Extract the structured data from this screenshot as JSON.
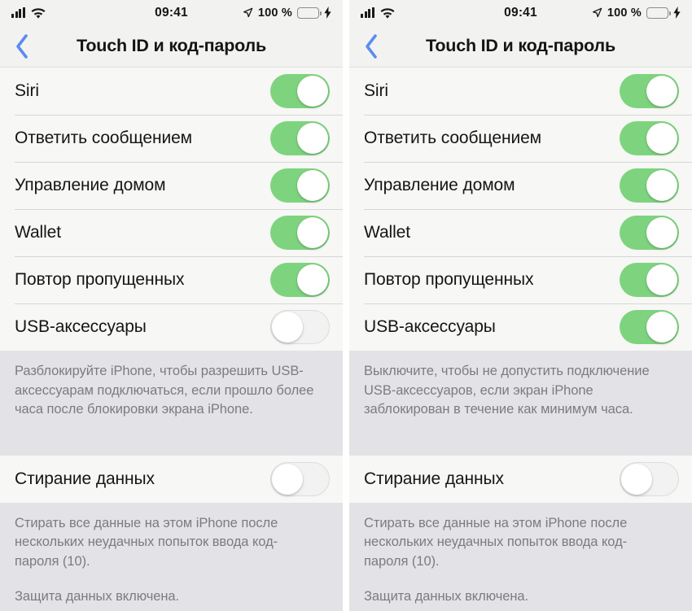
{
  "panels": [
    {
      "id": "left",
      "status_bar": {
        "signal_icon": "cellular-signal-icon",
        "wifi_icon": "wifi-icon",
        "time": "09:41",
        "location_icon": "location-arrow-icon",
        "battery_percent": "100 %",
        "battery_icon": "battery-full-icon",
        "charging_icon": "lightning-bolt-icon"
      },
      "nav": {
        "back_icon": "chevron-left-icon",
        "title": "Touch ID и код-пароль"
      },
      "sections": [
        {
          "rows": [
            {
              "label": "Siri",
              "toggle": "on"
            },
            {
              "label": "Ответить сообщением",
              "toggle": "on"
            },
            {
              "label": "Управление домом",
              "toggle": "on"
            },
            {
              "label": "Wallet",
              "toggle": "on"
            },
            {
              "label": "Повтор пропущенных",
              "toggle": "on"
            },
            {
              "label": "USB-аксессуары",
              "toggle": "off"
            }
          ],
          "footer": [
            "Разблокируйте iPhone, чтобы разрешить USB-аксессуарам подключаться, если прошло более часа после блокировки экрана iPhone."
          ]
        },
        {
          "rows": [
            {
              "label": "Стирание данных",
              "toggle": "off"
            }
          ],
          "footer": [
            "Стирать все данные на этом iPhone после нескольких неудачных попыток ввода код-пароля (10).",
            "Защита данных включена."
          ]
        }
      ]
    },
    {
      "id": "right",
      "status_bar": {
        "signal_icon": "cellular-signal-icon",
        "wifi_icon": "wifi-icon",
        "time": "09:41",
        "location_icon": "location-arrow-icon",
        "battery_percent": "100 %",
        "battery_icon": "battery-full-icon",
        "charging_icon": "lightning-bolt-icon"
      },
      "nav": {
        "back_icon": "chevron-left-icon",
        "title": "Touch ID и код-пароль"
      },
      "sections": [
        {
          "rows": [
            {
              "label": "Siri",
              "toggle": "on"
            },
            {
              "label": "Ответить сообщением",
              "toggle": "on"
            },
            {
              "label": "Управление домом",
              "toggle": "on"
            },
            {
              "label": "Wallet",
              "toggle": "on"
            },
            {
              "label": "Повтор пропущенных",
              "toggle": "on"
            },
            {
              "label": "USB-аксессуары",
              "toggle": "on"
            }
          ],
          "footer": [
            "Выключите, чтобы не допустить подключение USB-аксессуаров, если экран iPhone заблокирован в течение как минимум часа."
          ]
        },
        {
          "rows": [
            {
              "label": "Стирание данных",
              "toggle": "off"
            }
          ],
          "footer": [
            "Стирать все данные на этом iPhone после нескольких неудачных попыток ввода код-пароля (10).",
            "Защита данных включена."
          ]
        }
      ]
    }
  ],
  "colors": {
    "switch_on": "#7ed47e",
    "switch_off_track": "#f2f2f2",
    "accent_blue": "#5a8cf0",
    "footer_text": "#7b7b80",
    "group_bg": "#f7f7f5",
    "page_bg": "#e3e3e7",
    "battery_fill": "#6fd86f"
  }
}
